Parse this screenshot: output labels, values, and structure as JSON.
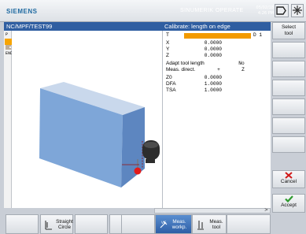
{
  "header": {
    "brand": "SIEMENS",
    "product": "SINUMERIK OPERATE",
    "date": "05/02/18",
    "time": "4:26 PM"
  },
  "titlebar": {
    "program_path": "NC/MPF/TEST99",
    "cycle_title": "Calibrate: length on edge"
  },
  "program_strip": {
    "lines": [
      "P",
      "",
      "END"
    ]
  },
  "params": [
    {
      "label": "T",
      "value": "",
      "extra": "D 1"
    },
    {
      "label": "X",
      "value": "0.0000"
    },
    {
      "label": "Y",
      "value": "0.0000"
    },
    {
      "label": "Z",
      "value": "0.0000"
    },
    {
      "label": "Adapt tool length",
      "value": "No"
    },
    {
      "label": "Meas. direct.",
      "value": "+",
      "extra": "Z"
    },
    {
      "label": "Z0",
      "value": "0.0000"
    },
    {
      "label": "DFA",
      "value": "1.0000"
    },
    {
      "label": "TSA",
      "value": "1.0000"
    }
  ],
  "softkeys_right": {
    "select_tool": [
      "Select",
      "tool"
    ],
    "cancel": "Cancel",
    "accept": "Accept"
  },
  "softkeys_bottom": {
    "straight_circle": [
      "Straight",
      "Circle"
    ],
    "meas_workp": [
      "Meas.",
      "workp."
    ],
    "meas_tool": [
      "Meas.",
      "tool"
    ]
  },
  "scroll_arrow": ">",
  "colors": {
    "title_bg": "#2f5ea1",
    "accent_orange": "#f29a00",
    "cancel_red": "#d01919",
    "accept_green": "#2f9a2f"
  }
}
